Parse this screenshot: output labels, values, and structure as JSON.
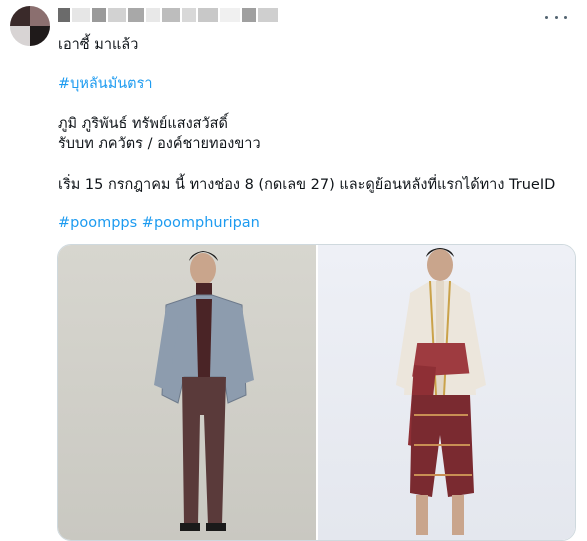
{
  "tweet": {
    "lines": [
      "เอาซี้ มาแล้ว",
      "#บุหลันมันตรา",
      "ภูมิ ภูริพันธ์  ทรัพย์แสงสวัสดิ์",
      "รับบท ภควัตร / องค์ชายทองขาว",
      "เริ่ม 15 กรกฎาคม นี้ ทางช่อง 8 (กดเลข 27) และดูย้อนหลังที่แรกได้ทาง TrueID"
    ],
    "hashtags": [
      "#poompps",
      "#poomphuripan"
    ]
  },
  "colors": {
    "link": "#1d9bf0",
    "text": "#0f1419",
    "border": "#cfd9de"
  },
  "icons": {
    "more": "more-horizontal-icon"
  }
}
